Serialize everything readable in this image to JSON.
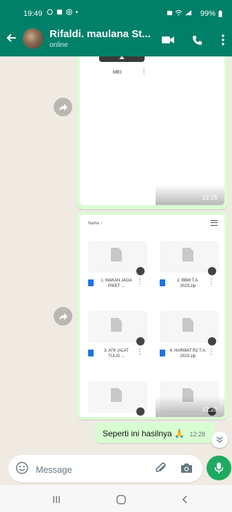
{
  "status_bar": {
    "time": "19:49",
    "left_icons": [
      "whatsapp-icon",
      "gallery-icon",
      "instagram-icon",
      "dot-icon"
    ],
    "right_icons": [
      "alarm-icon",
      "wifi-icon",
      "signal-icon"
    ],
    "battery": "99%"
  },
  "header": {
    "contact_name": "Rifaldi. maulana St...",
    "status": "online",
    "actions": [
      "video-call-icon",
      "voice-call-icon",
      "more-options-icon"
    ]
  },
  "messages": [
    {
      "type": "image",
      "forwardable": true,
      "content": {
        "file_label": "MEI"
      },
      "time": "12:28"
    },
    {
      "type": "image",
      "forwardable": true,
      "content": {
        "sort_label": "Nama ↑",
        "files": [
          {
            "name": "1. MAKAN JAGA PIKET ..."
          },
          {
            "name": "2. BBM T.A. 2023.zip"
          },
          {
            "name": "3. ATK (ALAT TULIS ..."
          },
          {
            "name": "4. HARWAT R2 T.A. 2023.zip"
          }
        ]
      },
      "time": "12:28"
    },
    {
      "type": "text",
      "text": "Seperti ini hasilnya 🙏",
      "time": "12:28"
    }
  ],
  "composer": {
    "placeholder": "Message",
    "icons": [
      "emoji-icon",
      "attach-icon",
      "camera-icon",
      "mic-icon"
    ]
  },
  "nav_bar": [
    "recent-apps-icon",
    "home-icon",
    "back-nav-icon"
  ],
  "colors": {
    "header": "#008069",
    "chat_bg": "#efeae2",
    "outgoing_bubble": "#d9fdd3",
    "mic_button": "#1daa61"
  }
}
